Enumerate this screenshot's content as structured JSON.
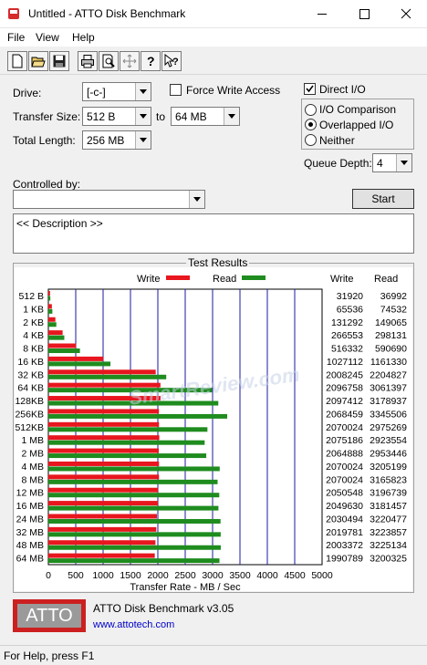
{
  "window": {
    "title": "Untitled - ATTO Disk Benchmark"
  },
  "menu": [
    "File",
    "View",
    "Help"
  ],
  "toolbar": [
    "new-icon",
    "open-icon",
    "save-icon",
    "print-icon",
    "print-preview-icon",
    "move-icon",
    "help-icon",
    "context-help-icon"
  ],
  "form": {
    "drive_label": "Drive:",
    "drive_value": "[-c-]",
    "transfer_label": "Transfer Size:",
    "transfer_from": "512 B",
    "to_label": "to",
    "transfer_to": "64 MB",
    "total_length_label": "Total Length:",
    "total_length_value": "256 MB",
    "force_write_label": "Force Write Access",
    "direct_io_label": "Direct I/O",
    "io_comparison_label": "I/O Comparison",
    "overlapped_io_label": "Overlapped I/O",
    "neither_label": "Neither",
    "queue_depth_label": "Queue Depth:",
    "queue_depth_value": "4",
    "controlled_by_label": "Controlled by:",
    "controlled_by_value": "",
    "start_label": "Start",
    "description": "<< Description >>"
  },
  "results_title": "Test Results",
  "chart_data": {
    "type": "bar",
    "orientation": "horizontal",
    "xlabel": "Transfer Rate - MB / Sec",
    "xlim": [
      0,
      5000
    ],
    "xticks": [
      "0",
      "500",
      "1000",
      "1500",
      "2000",
      "2500",
      "3000",
      "3500",
      "4000",
      "4500",
      "5000"
    ],
    "grid": true,
    "legend": "top",
    "colors": {
      "write": "#e8161e",
      "read": "#1e8c1e"
    },
    "column_headers": {
      "write": "Write",
      "read": "Read"
    },
    "categories": [
      "512 B",
      "1 KB",
      "2 KB",
      "4 KB",
      "8 KB",
      "16 KB",
      "32 KB",
      "64 KB",
      "128KB",
      "256KB",
      "512KB",
      "1 MB",
      "2 MB",
      "4 MB",
      "8 MB",
      "12 MB",
      "16 MB",
      "24 MB",
      "32 MB",
      "48 MB",
      "64 MB"
    ],
    "series": [
      {
        "name": "Write",
        "values_kb": [
          31920,
          65536,
          131292,
          266553,
          516332,
          1027112,
          2008245,
          2096758,
          2097412,
          2068459,
          2070024,
          2075186,
          2064888,
          2070024,
          2070024,
          2050548,
          2049630,
          2030494,
          2019781,
          2003372,
          1990789
        ]
      },
      {
        "name": "Read",
        "values_kb": [
          36992,
          74532,
          149065,
          298131,
          590690,
          1161330,
          2204827,
          3061397,
          3178937,
          3345506,
          2975269,
          2923554,
          2953446,
          3205199,
          3165823,
          3196739,
          3181457,
          3220477,
          3223857,
          3225134,
          3200325
        ]
      }
    ]
  },
  "watermark": "SmartReview.com",
  "footer": {
    "logo": "ATTO",
    "app_name": "ATTO Disk Benchmark v3.05",
    "url": "www.attotech.com"
  },
  "status": "For Help, press F1"
}
